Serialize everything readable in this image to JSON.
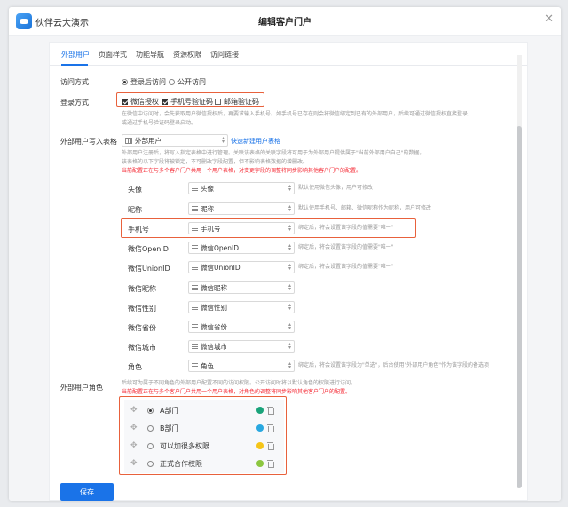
{
  "app": {
    "name": "伙伴云大演示"
  },
  "page": {
    "title": "编辑客户门户"
  },
  "tabs": [
    {
      "label": "外部用户",
      "active": true
    },
    {
      "label": "页面样式"
    },
    {
      "label": "功能导航"
    },
    {
      "label": "资源权限"
    },
    {
      "label": "访问链接"
    }
  ],
  "access_mode": {
    "label": "访问方式",
    "options": [
      {
        "label": "登录后访问",
        "selected": true
      },
      {
        "label": "公开访问",
        "selected": false
      }
    ]
  },
  "login_mode": {
    "label": "登录方式",
    "options": [
      {
        "label": "微信授权",
        "checked": true
      },
      {
        "label": "手机号验证码",
        "checked": true
      },
      {
        "label": "邮箱验证码",
        "checked": false
      }
    ],
    "hint1": "在微信中访问时，会先获取用户微信授权后，再要求输入手机号。如手机号已存在则会将微信绑定到已有的外部用户，后续可通过微信授权直接登录，",
    "hint2": "或通过手机号验证码登录启动。"
  },
  "user_table": {
    "label": "外部用户写入表格",
    "selected": "外部用户",
    "quick_create": "快速新建用户表格",
    "hint1": "外部用户注册后，将写入指定表格中进行管理。关联该表格的关联字段将可用于为外部用户提供属于\"当前外部用户自己\"的数据。",
    "hint2": "该表格的以下字段将被锁定，不可删改字段配置，但不影响表格数据的增删改。",
    "warn": "当前配置正在与多个客户门户共用一个用户表格，对变更字段的调整将同步影响其他客户门户的配置。"
  },
  "fields": [
    {
      "label": "头像",
      "value": "头像",
      "hint": "默认使用微信头像，用户可修改"
    },
    {
      "label": "昵称",
      "value": "昵称",
      "hint": "默认使用手机号、邮箱、微信昵称作为昵称，用户可修改"
    },
    {
      "label": "手机号",
      "value": "手机号",
      "hint": "绑定后，将会设置该字段的值需要\"唯一\""
    },
    {
      "label": "微信OpenID",
      "value": "微信OpenID",
      "hint": "绑定后，将会设置该字段的值需要\"唯一\""
    },
    {
      "label": "微信UnionID",
      "value": "微信UnionID",
      "hint": "绑定后，将会设置该字段的值需要\"唯一\""
    },
    {
      "label": "微信昵称",
      "value": "微信昵称",
      "hint": ""
    },
    {
      "label": "微信性别",
      "value": "微信性别",
      "hint": ""
    },
    {
      "label": "微信省份",
      "value": "微信省份",
      "hint": ""
    },
    {
      "label": "微信城市",
      "value": "微信城市",
      "hint": ""
    },
    {
      "label": "角色",
      "value": "角色",
      "hint": "绑定后，将会设置该字段为\"单选\"，后台使用\"外部用户角色\"作为该字段的备选项"
    }
  ],
  "roles": {
    "label": "外部用户角色",
    "hint": "后续可为属于不同角色的外部用户配置不同的访问权限。公开访问时将以默认角色的权限进行访问。",
    "warn": "当前配置正在与多个客户门户共用一个用户表格，对角色的调整将同步影响其他客户门户的配置。",
    "items": [
      {
        "name": "A部门",
        "selected": true,
        "color": "#1aa37a"
      },
      {
        "name": "B部门",
        "selected": false,
        "color": "#29a8e0"
      },
      {
        "name": "可以加很多权限",
        "selected": false,
        "color": "#f5c518"
      },
      {
        "name": "正式合作权限",
        "selected": false,
        "color": "#8cc63f"
      }
    ]
  },
  "save_label": "保存"
}
